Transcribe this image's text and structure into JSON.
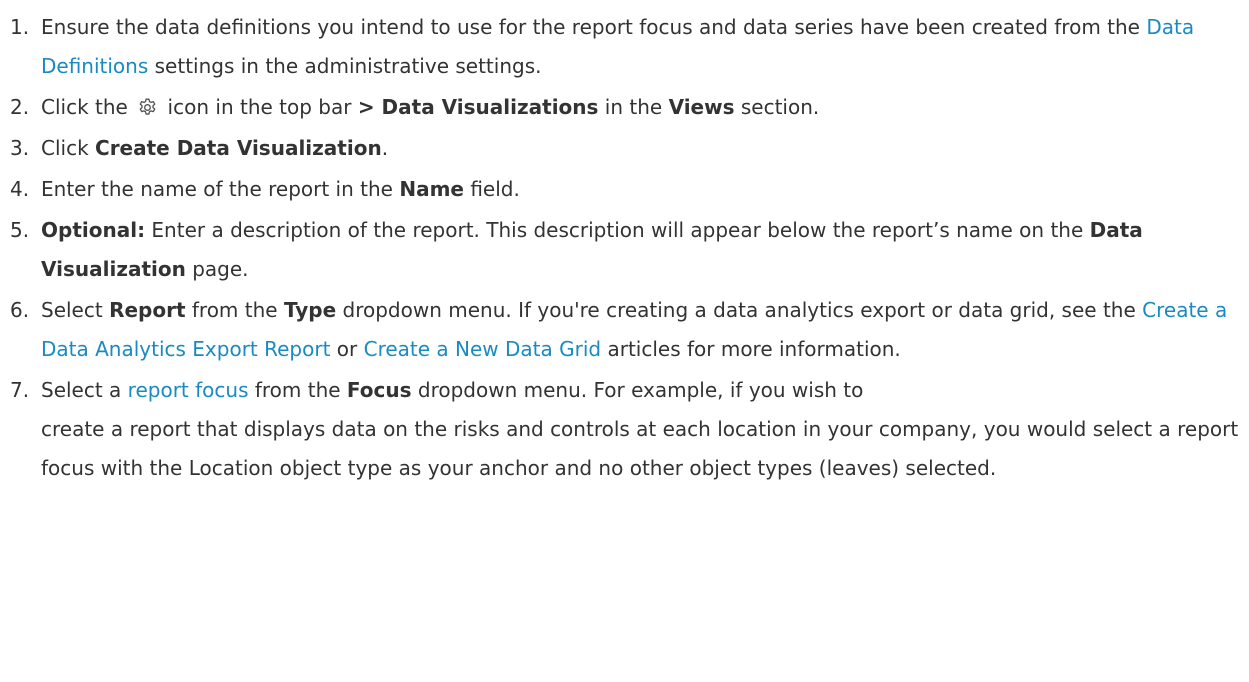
{
  "steps": [
    {
      "num": "1.",
      "t1": "Ensure the data definitions you intend to use for the report focus and data series have been created from the ",
      "link1": "Data Definitions",
      "t2": " settings in the administrative settings."
    },
    {
      "num": "2.",
      "t1": "Click the ",
      "icon": "gear-icon",
      "t2": " icon in the top bar ",
      "b1": "> Data Visualizations",
      "t3": " in the ",
      "b2": "Views",
      "t4": " section."
    },
    {
      "num": "3.",
      "t1": "Click ",
      "b1": "Create Data Visualization",
      "t2": "."
    },
    {
      "num": "4.",
      "t1": "Enter the name of the report in the ",
      "b1": "Name",
      "t2": " field."
    },
    {
      "num": "5.",
      "b1": "Optional:",
      "t1": " Enter a description of the report. This description will appear below the report’s name on the ",
      "b2": "Data Visualization",
      "t2": " page."
    },
    {
      "num": "6.",
      "t1": "Select ",
      "b1": "Report",
      "t2": " from the ",
      "b2": "Type",
      "t3": " dropdown menu. If you're creating a data analytics export or data grid, see the ",
      "link1": "Create a Data Analytics Export Report",
      "t4": " or ",
      "link2": "Create a New Data Grid",
      "t5": " articles for more information."
    },
    {
      "num": "7.",
      "t1": "Select a ",
      "link1": "report focus",
      "t2": " from the ",
      "b1": "Focus",
      "t3": " dropdown menu. For example, if you wish to",
      "t4": "create a report that displays data on the risks and controls at each location in your company, you would select a report focus with the Location object type as your anchor and no other object types (leaves) selected."
    }
  ],
  "colors": {
    "text": "#333333",
    "link": "#1a8ac2",
    "icon": "#555555"
  }
}
